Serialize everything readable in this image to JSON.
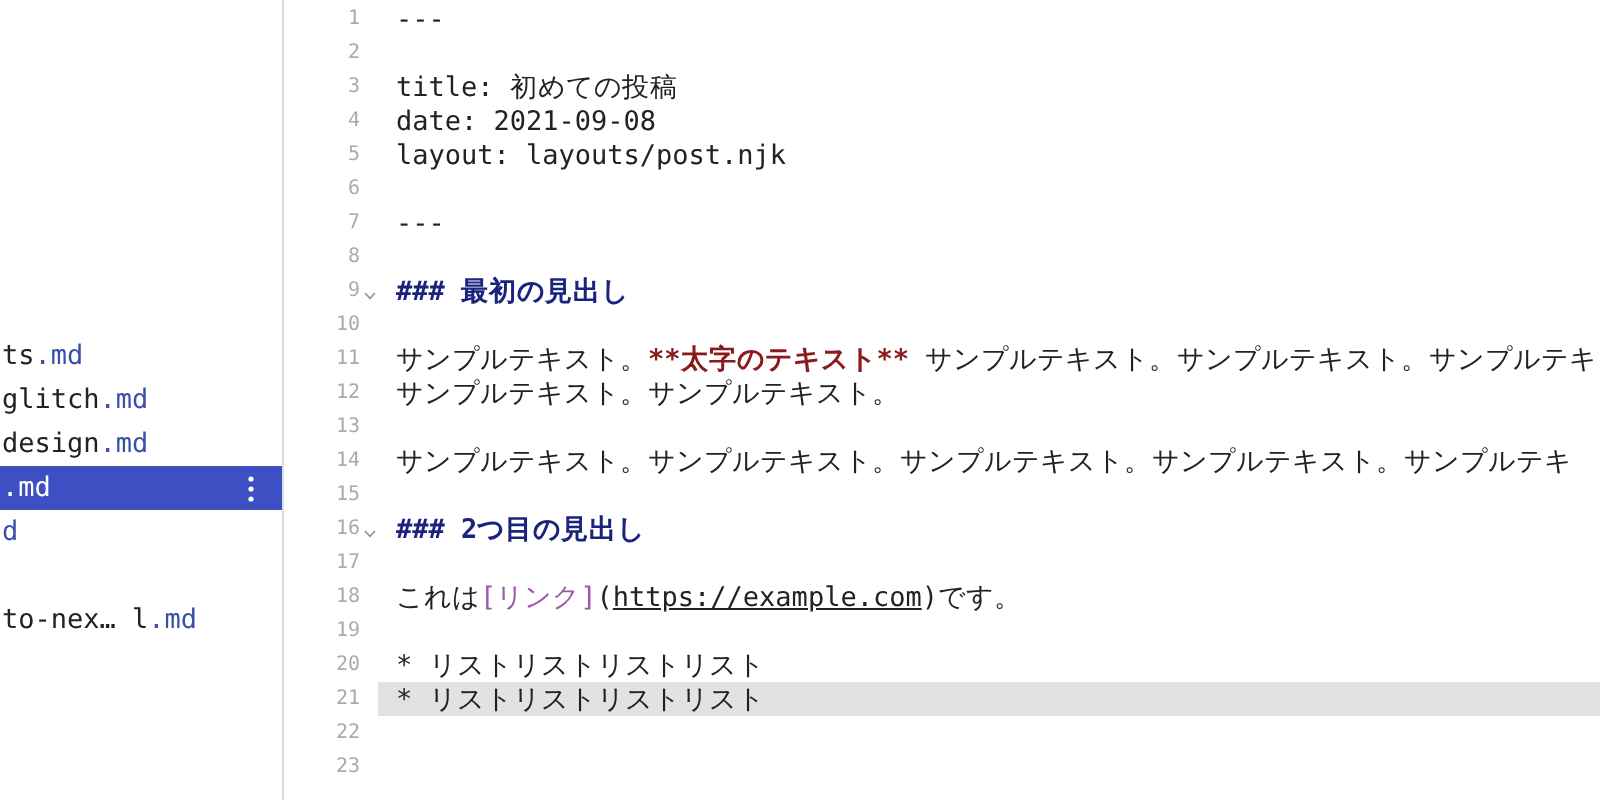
{
  "sidebar": {
    "files": [
      {
        "name": "ts",
        "ext": ".md",
        "selected": false,
        "gap_before": false
      },
      {
        "name": "glitch",
        "ext": ".md",
        "selected": false,
        "gap_before": false
      },
      {
        "name": "design",
        "ext": ".md",
        "selected": false,
        "gap_before": false
      },
      {
        "ext": ".md",
        "selected": true,
        "gap_before": false
      },
      {
        "ext": "d",
        "selected": false,
        "gap_before": false
      },
      {
        "name": "to-nex… l",
        "ext": ".md",
        "selected": false,
        "gap_before": true
      }
    ]
  },
  "editor": {
    "lines": [
      {
        "number": "1",
        "fold": false,
        "active": false,
        "segments": [
          {
            "kind": "plain",
            "text": "---"
          }
        ]
      },
      {
        "number": "2",
        "fold": false,
        "active": false
      },
      {
        "number": "3",
        "fold": false,
        "active": false,
        "segments": [
          {
            "kind": "plain",
            "text": "title: 初めての投稿"
          }
        ]
      },
      {
        "number": "4",
        "fold": false,
        "active": false,
        "segments": [
          {
            "kind": "plain",
            "text": "date: 2021-09-08"
          }
        ]
      },
      {
        "number": "5",
        "fold": false,
        "active": false,
        "segments": [
          {
            "kind": "plain",
            "text": "layout: layouts/post.njk"
          }
        ]
      },
      {
        "number": "6",
        "fold": false,
        "active": false
      },
      {
        "number": "7",
        "fold": false,
        "active": false,
        "segments": [
          {
            "kind": "plain",
            "text": "---"
          }
        ]
      },
      {
        "number": "8",
        "fold": false,
        "active": false
      },
      {
        "number": "9",
        "fold": true,
        "active": false,
        "segments": [
          {
            "kind": "heading",
            "text": "### 最初の見出し"
          }
        ]
      },
      {
        "number": "10",
        "fold": false,
        "active": false
      },
      {
        "number": "11",
        "fold": false,
        "active": false,
        "segments": [
          {
            "kind": "plain",
            "text": "サンプルテキスト。"
          },
          {
            "kind": "bold",
            "text": "**太字のテキスト**"
          },
          {
            "kind": "plain",
            "text": " サンプルテキスト。サンプルテキスト。サンプルテキ"
          }
        ]
      },
      {
        "number": "12",
        "fold": false,
        "active": false,
        "segments": [
          {
            "kind": "plain",
            "text": "サンプルテキスト。サンプルテキスト。"
          }
        ]
      },
      {
        "number": "13",
        "fold": false,
        "active": false
      },
      {
        "number": "14",
        "fold": false,
        "active": false,
        "segments": [
          {
            "kind": "plain",
            "text": "サンプルテキスト。サンプルテキスト。サンプルテキスト。サンプルテキスト。サンプルテキ"
          }
        ]
      },
      {
        "number": "15",
        "fold": false,
        "active": false
      },
      {
        "number": "16",
        "fold": true,
        "active": false,
        "segments": [
          {
            "kind": "heading",
            "text": "### 2つ目の見出し"
          }
        ]
      },
      {
        "number": "17",
        "fold": false,
        "active": false
      },
      {
        "number": "18",
        "fold": false,
        "active": false,
        "segments": [
          {
            "kind": "plain",
            "text": "これは"
          },
          {
            "kind": "link",
            "text": "[リンク]"
          },
          {
            "kind": "plain",
            "text": "("
          },
          {
            "kind": "url",
            "text": "https://example.com"
          },
          {
            "kind": "plain",
            "text": ")です。"
          }
        ]
      },
      {
        "number": "19",
        "fold": false,
        "active": false
      },
      {
        "number": "20",
        "fold": false,
        "active": false,
        "segments": [
          {
            "kind": "plain",
            "text": "* リストリストリストリスト"
          }
        ]
      },
      {
        "number": "21",
        "fold": false,
        "active": true,
        "segments": [
          {
            "kind": "plain",
            "text": "* リストリストリストリスト"
          }
        ]
      },
      {
        "number": "22",
        "fold": false,
        "active": false
      },
      {
        "number": "23",
        "fold": false,
        "active": false
      }
    ]
  }
}
